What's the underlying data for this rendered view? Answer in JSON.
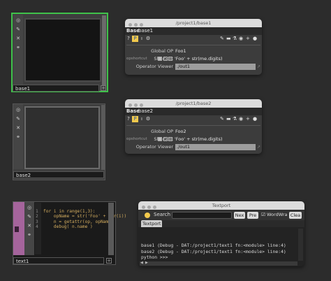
{
  "network": {
    "op1": {
      "label": "base1",
      "sidebar_icons": [
        "target-icon",
        "brush-icon",
        "cross-icon",
        "link-icon"
      ]
    },
    "op2": {
      "label": "base2"
    },
    "op3": {
      "label": "text1"
    },
    "op3_code": [
      "for i in range(1,3):",
      "    opName = str('Foo' + str(i))",
      "    n = getattr(op, opName)",
      "    debug( n.name )"
    ],
    "op3_line_numbers": [
      "1",
      "2",
      "3",
      "4"
    ]
  },
  "dialog1": {
    "title": "/project1/base1",
    "op_type": "Base",
    "op_name": "base1",
    "section": "Global OP Shortcut",
    "shortcut_value": "Foo1",
    "param_small": "opshortcut",
    "expression": "'Foo' + str(me.digits)",
    "viewer_label": "Operator Viewer",
    "viewer_value": "./out1"
  },
  "dialog2": {
    "title": "/project1/base2",
    "op_type": "Base",
    "op_name": "base2",
    "section": "Global OP Shortcut",
    "shortcut_value": "Foo2",
    "param_small": "opshortcut",
    "expression": "'Foo' + str(me.digits)",
    "viewer_label": "Operator Viewer",
    "viewer_value": "./out1"
  },
  "textport": {
    "title": "Textport",
    "search_label": "Search",
    "next_label": "Nex",
    "prev_label": "Pre",
    "wordwrap_label": "WordWra",
    "clear_label": "Clea",
    "tab_label": "Textport",
    "output_lines": [
      "base1 (Debug - DAT:/project1/text1 fn:<module> line:4)",
      "base2 (Debug - DAT:/project1/text1 fn:<module> line:4)",
      "python >>>"
    ]
  }
}
